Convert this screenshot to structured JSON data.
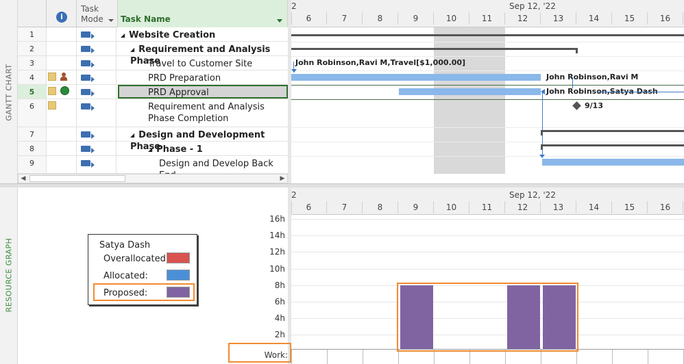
{
  "side_labels": {
    "gantt": "GANTT CHART",
    "resource": "RESOURCE GRAPH"
  },
  "header": {
    "info": "i",
    "task_mode_line1": "Task",
    "task_mode_line2": "Mode",
    "task_name": "Task Name"
  },
  "tasks": [
    {
      "id": "1",
      "name": "Website Creation",
      "bold": true,
      "indent": 0,
      "collapse": "◢"
    },
    {
      "id": "2",
      "name": "Requirement and Analysis Phase",
      "bold": true,
      "indent": 1,
      "collapse": "◢"
    },
    {
      "id": "3",
      "name": "Travel to Customer Site",
      "bold": false,
      "indent": 2
    },
    {
      "id": "4",
      "name": "PRD Preparation",
      "bold": false,
      "indent": 2
    },
    {
      "id": "5",
      "name": "PRD Approval",
      "bold": false,
      "indent": 2
    },
    {
      "id": "6",
      "name": "Requirement and Analysis",
      "name2": "Phase Completion",
      "bold": false,
      "indent": 2
    },
    {
      "id": "7",
      "name": "Design and Development Phase",
      "bold": true,
      "indent": 1,
      "collapse": "◢"
    },
    {
      "id": "8",
      "name": "Phase - 1",
      "bold": true,
      "indent": 2,
      "collapse": "◢"
    },
    {
      "id": "9",
      "name": "Design and Develop Back End",
      "bold": false,
      "indent": 3
    }
  ],
  "timescale": {
    "week_label": "Sep 12, '22",
    "partial_left": "2",
    "days": [
      "6",
      "7",
      "8",
      "9",
      "10",
      "11",
      "12",
      "13",
      "14",
      "15",
      "16"
    ]
  },
  "bar_labels": {
    "travel": "John Robinson,Ravi M,Travel[$1,000.00]",
    "prd_prep": "John Robinson,Ravi M",
    "prd_approval": "John Robinson,Satya Dash",
    "milestone": "9/13"
  },
  "resource_graph": {
    "y_ticks": [
      "16h",
      "14h",
      "12h",
      "10h",
      "8h",
      "6h",
      "4h",
      "2h"
    ],
    "work_label": "Work:",
    "proposed_color": "#8064a2",
    "proposed_hours": [
      {
        "day": "9",
        "hours": 8
      },
      {
        "day": "12",
        "hours": 8
      },
      {
        "day": "13",
        "hours": 8
      }
    ]
  },
  "legend": {
    "resource": "Satya Dash",
    "overallocated": "Overallocated:",
    "allocated": "Allocated:",
    "proposed": "Proposed:",
    "overallocated_color": "#d9534f",
    "allocated_color": "#4a8fd8",
    "proposed_color": "#8064a2"
  }
}
